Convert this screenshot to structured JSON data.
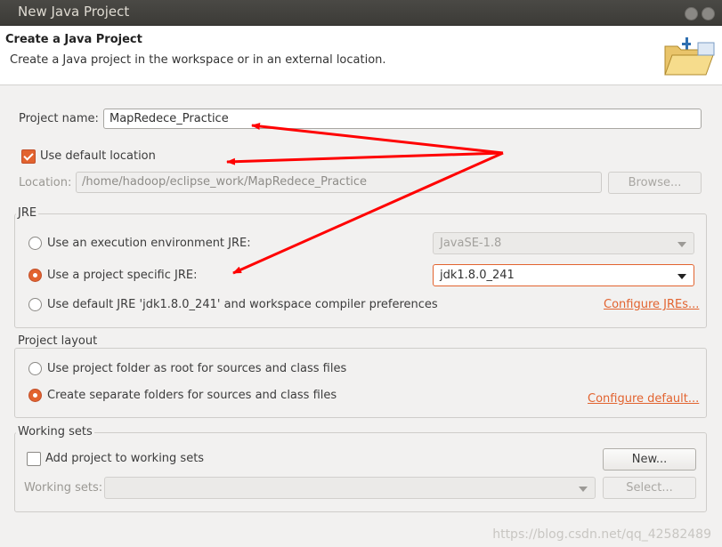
{
  "window": {
    "title": "New Java Project"
  },
  "header": {
    "title": "Create a Java Project",
    "description": "Create a Java project in the workspace or in an external location.",
    "icon": "folder-icon"
  },
  "project": {
    "name_label": "Project name:",
    "name_value": "MapRedece_Practice",
    "use_default_location_label": "Use default location",
    "use_default_location_checked": true,
    "location_label": "Location:",
    "location_value": "/home/hadoop/eclipse_work/MapRedece_Practice",
    "browse_label": "Browse..."
  },
  "jre": {
    "group_title": "JRE",
    "option_exec_env_label": "Use an execution environment JRE:",
    "exec_env_value": "JavaSE-1.8",
    "option_project_specific_label": "Use a project specific JRE:",
    "project_specific_value": "jdk1.8.0_241",
    "option_default_label": "Use default JRE 'jdk1.8.0_241' and workspace compiler preferences",
    "configure_jres_label": "Configure JREs...",
    "selected": "project_specific"
  },
  "layout": {
    "group_title": "Project layout",
    "option_root_label": "Use project folder as root for sources and class files",
    "option_separate_label": "Create separate folders for sources and class files",
    "configure_default_label": "Configure default...",
    "selected": "separate"
  },
  "working_sets": {
    "group_title": "Working sets",
    "add_label": "Add project to working sets",
    "add_checked": false,
    "new_label": "New...",
    "sets_label": "Working sets:",
    "sets_value": "",
    "select_label": "Select..."
  },
  "watermark": "https://blog.csdn.net/qq_42582489",
  "colors": {
    "accent": "#e2632f",
    "annotation_arrow": "#ff0000",
    "titlebar": "#3c3b37"
  }
}
